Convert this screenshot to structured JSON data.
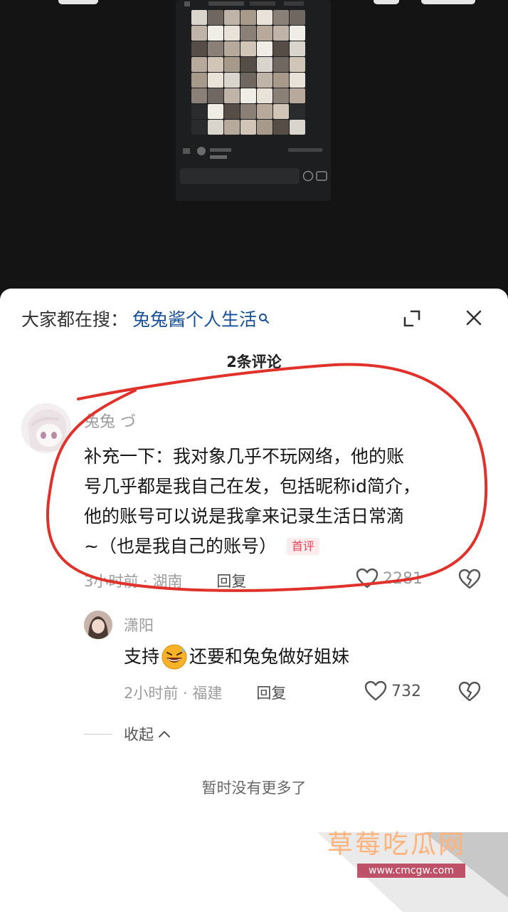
{
  "search": {
    "prefix": "大家都在搜：",
    "term": "兔兔酱个人生活",
    "term_color": "#17509a"
  },
  "header": {
    "count_title": "2条评论",
    "expand_icon": "expand-icon",
    "close_icon": "close-icon"
  },
  "comment": {
    "username": "兔兔 づ",
    "lines": [
      "补充一下：我对象几乎不玩网络，他的账",
      "号几乎都是我自己在发，包括昵称id简介，",
      "他的账号可以说是我拿来记录生活日常滴",
      "~（也是我自己的账号）"
    ],
    "badge": "首评",
    "badge_color": "#e8445a",
    "time_location": "3小时前 · 湖南",
    "reply_label": "回复",
    "likes": "2281"
  },
  "reply": {
    "username": "潇阳",
    "text_before": "支持",
    "emoji_icon": "grinning-sweat-emoji-icon",
    "text_after": "还要和兔兔做好姐妹",
    "time_location": "2小时前 · 福建",
    "reply_label": "回复",
    "likes": "732"
  },
  "collapse": {
    "label": "收起"
  },
  "footer": {
    "no_more": "暂时没有更多了"
  },
  "watermark": {
    "text": "草莓吃瓜网",
    "url": "www.cmcgw.com"
  },
  "annotation": {
    "color": "#e0312b"
  }
}
